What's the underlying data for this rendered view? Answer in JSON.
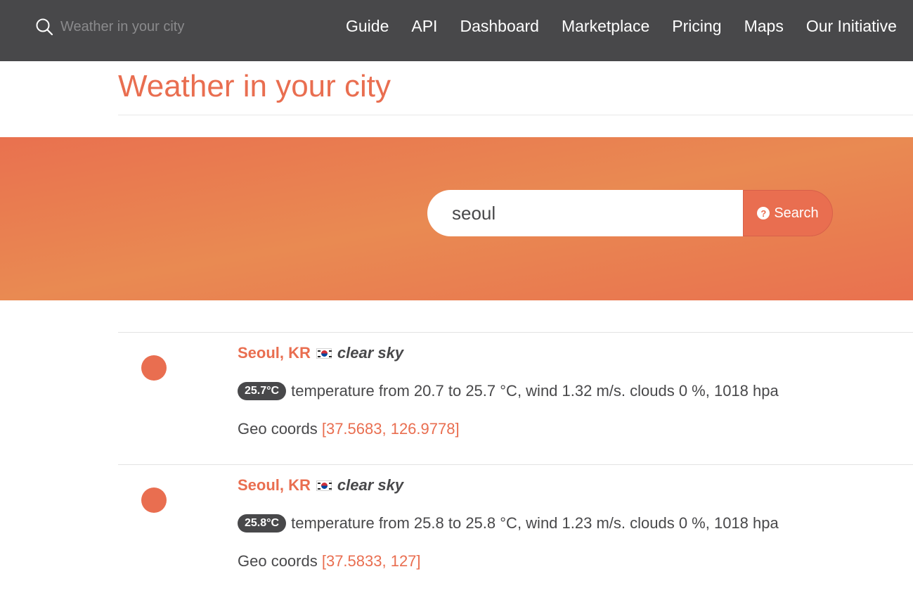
{
  "header": {
    "search_placeholder": "Weather in your city",
    "search_icon": "search-icon",
    "nav": [
      "Guide",
      "API",
      "Dashboard",
      "Marketplace",
      "Pricing",
      "Maps",
      "Our Initiative"
    ]
  },
  "page": {
    "title": "Weather in your city"
  },
  "search": {
    "value": "seoul",
    "button_label": "Search",
    "button_icon": "?"
  },
  "colors": {
    "accent": "#e96e50",
    "dark": "#48484a"
  },
  "results": [
    {
      "city": "Seoul, KR",
      "description": "clear sky",
      "temp_badge": "25.7°C",
      "details": "temperature from 20.7 to 25.7 °C, wind 1.32 m/s. clouds 0 %, 1018 hpa",
      "geo_label": "Geo coords",
      "coords": "[37.5683, 126.9778]"
    },
    {
      "city": "Seoul, KR",
      "description": "clear sky",
      "temp_badge": "25.8°C",
      "details": "temperature from 25.8 to 25.8 °C, wind 1.23 m/s. clouds 0 %, 1018 hpa",
      "geo_label": "Geo coords",
      "coords": "[37.5833, 127]"
    }
  ]
}
